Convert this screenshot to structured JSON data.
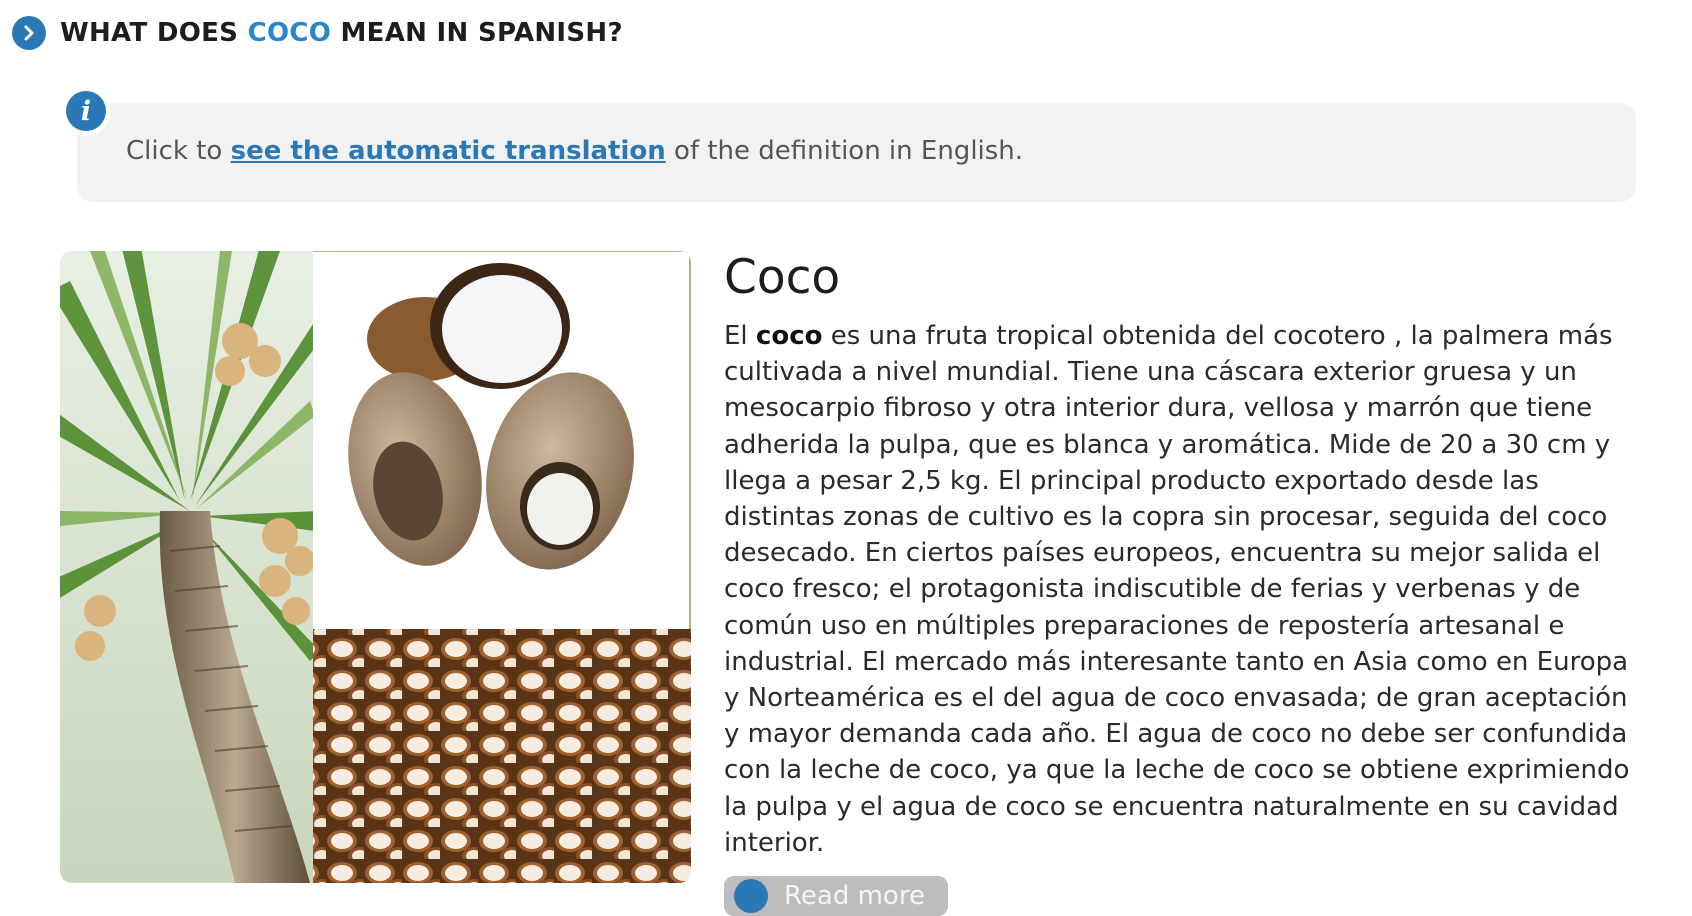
{
  "header": {
    "prefix": "WHAT DOES ",
    "word": "COCO",
    "suffix": " MEAN IN SPANISH?"
  },
  "info": {
    "pre": "Click to ",
    "link": "see the automatic translation",
    "post": " of the definition in English."
  },
  "entry": {
    "title": "Coco",
    "def_pre": "El ",
    "def_bold": "coco",
    "def_rest": " es una fruta tropical obtenida del cocotero , la palmera más cultivada a nivel mundial. Tiene una cáscara exterior gruesa y un mesocarpio fibroso y otra interior dura, vellosa y marrón que tiene adherida la pulpa, que es blanca y aromática. Mide de 20 a 30 cm y llega a pesar 2,5 kg. El principal producto exportado desde las distintas zonas de cultivo es la copra sin procesar, seguida del coco desecado. En ciertos países europeos, encuentra su mejor salida el coco fresco; el protagonista indiscutible de ferias y verbenas y de común uso en múltiples preparaciones de repostería artesanal e industrial. El mercado más interesante tanto en Asia como en Europa y Norteamérica es el del agua de coco envasada; de gran aceptación y mayor demanda cada año. El agua de coco no debe ser confundida con la leche de coco, ya que la leche de coco se obtiene exprimiendo la pulpa y el agua de coco se encuentra naturalmente en su cavidad interior."
  },
  "read_more": {
    "label": "Read more"
  },
  "colors": {
    "accent": "#2a78b6",
    "accent_light": "#2a86c8",
    "info_bg": "#f2f2f2"
  },
  "icons": {
    "header": "chevron-right-icon",
    "info": "info-icon",
    "read_more": "plus-circle-icon"
  }
}
